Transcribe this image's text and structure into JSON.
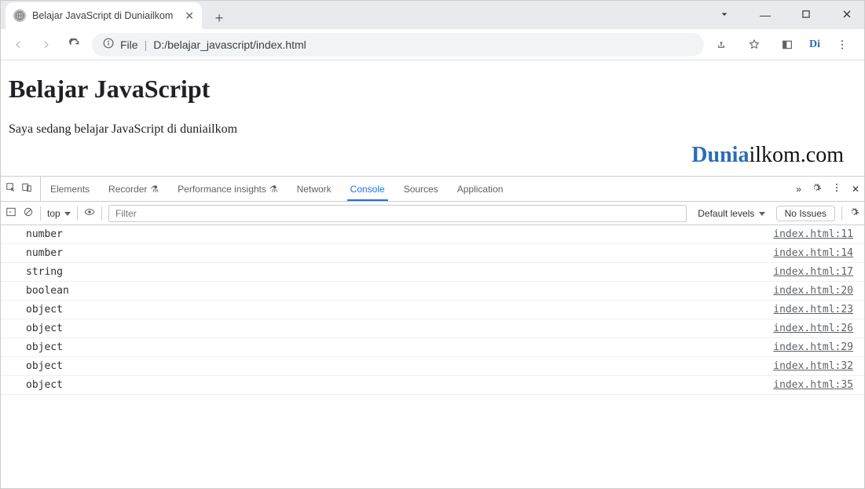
{
  "window": {
    "tab_title": "Belajar JavaScript di Duniailkom"
  },
  "toolbar": {
    "url_prefix": "File",
    "url_sep": "|",
    "url": "D:/belajar_javascript/index.html",
    "extension_badge": "Di"
  },
  "page": {
    "heading": "Belajar JavaScript",
    "paragraph": "Saya sedang belajar JavaScript di duniailkom",
    "watermark_blue": "Dunia",
    "watermark_black": "ilkom.com"
  },
  "devtools": {
    "tabs": [
      "Elements",
      "Recorder",
      "Performance insights",
      "Network",
      "Console",
      "Sources",
      "Application"
    ],
    "active_tab": "Console",
    "console_toolbar": {
      "context": "top",
      "filter_placeholder": "Filter",
      "levels": "Default levels",
      "issues": "No Issues"
    },
    "console_rows": [
      {
        "msg": "number",
        "src": "index.html:11"
      },
      {
        "msg": "number",
        "src": "index.html:14"
      },
      {
        "msg": "string",
        "src": "index.html:17"
      },
      {
        "msg": "boolean",
        "src": "index.html:20"
      },
      {
        "msg": "object",
        "src": "index.html:23"
      },
      {
        "msg": "object",
        "src": "index.html:26"
      },
      {
        "msg": "object",
        "src": "index.html:29"
      },
      {
        "msg": "object",
        "src": "index.html:32"
      },
      {
        "msg": "object",
        "src": "index.html:35"
      }
    ]
  }
}
